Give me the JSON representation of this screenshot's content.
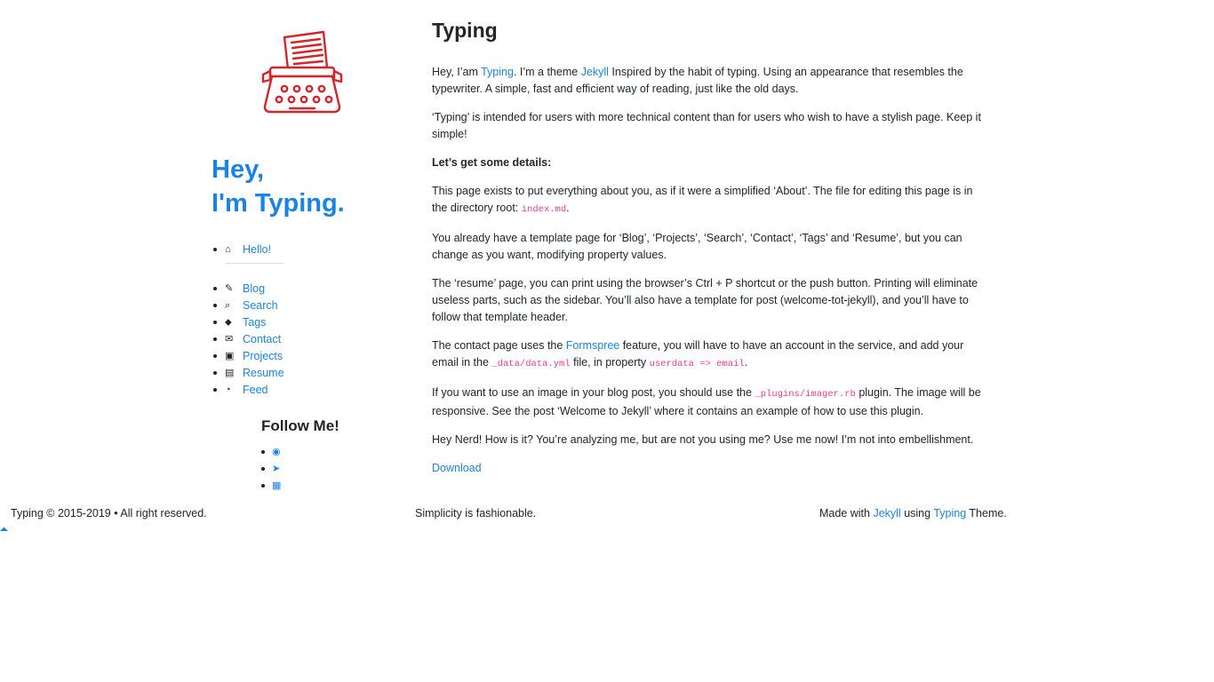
{
  "sidebar": {
    "greeting_line1": "Hey,",
    "greeting_line2": "I'm Typing.",
    "nav_top": [
      {
        "label": "Hello!",
        "icon": "home-icon"
      }
    ],
    "nav_items": [
      {
        "label": "Blog",
        "icon": "edit-icon"
      },
      {
        "label": "Search",
        "icon": "search-icon"
      },
      {
        "label": "Tags",
        "icon": "tags-icon"
      },
      {
        "label": "Contact",
        "icon": "envelope-icon"
      },
      {
        "label": "Projects",
        "icon": "briefcase-icon"
      },
      {
        "label": "Resume",
        "icon": "file-icon"
      },
      {
        "label": "Feed",
        "icon": "rss-icon"
      }
    ],
    "follow_title": "Follow Me!",
    "social": [
      {
        "icon": "github-icon"
      },
      {
        "icon": "twitter-icon"
      },
      {
        "icon": "linkedin-icon"
      }
    ]
  },
  "content": {
    "title": "Typing",
    "p1": {
      "a": "Hey, I’am ",
      "link1": "Typing",
      "b": ". I’m a theme ",
      "link2": "Jekyll",
      "c": " Inspired by the habit of typing. Using an appearance that resembles the typewriter. A simple, fast and efficient way of reading, just like the old days."
    },
    "p2": "‘Typing’ is intended for users with more technical content than for users who wish to have a stylish page. Keep it simple!",
    "p3": "Let’s get some details:",
    "p4": {
      "a": "This page exists to put everything about you, as if it were a simplified ‘About’. The file for editing this page is in the directory root: ",
      "code": "index.md",
      "b": "."
    },
    "p5": "You already have a template page for ‘Blog’, ‘Projects’, ‘Search’, ‘Contact’, ‘Tags’ and ‘Resume’, but you can change as you want, modifying property values.",
    "p6": "The ‘resume’ page, you can print using the browser’s Ctrl + P shortcut or the push button. Printing will eliminate useless parts, such as the sidebar. You’ll also have a template for post (welcome-tot-jekyll), and you’ll have to follow that template header.",
    "p7": {
      "a": "The contact page uses the ",
      "link": "Formspree",
      "b": " feature, you will have to have an account in the service, and add your email in the ",
      "code1": "_data/data.yml",
      "c": " file, in property ",
      "code2": "userdata => email",
      "d": "."
    },
    "p8": {
      "a": "If you want to use an image in your blog post, you should use the ",
      "code": "_plugins/imager.rb",
      "b": " plugin. The image will be responsive. See the post ‘Welcome to Jekyll’ where it contains an example of how to use this plugin."
    },
    "p9": "Hey Nerd! How is it? You’re analyzing me, but are not you using me? Use me now! I’m not into embellishment.",
    "download": "Download"
  },
  "footer": {
    "left": "Typing © 2015-2019 • All right reserved.",
    "center": "Simplicity is fashionable.",
    "right_a": "Made with ",
    "right_link1": "Jekyll",
    "right_b": " using ",
    "right_link2": "Typing",
    "right_c": " Theme."
  },
  "colors": {
    "accent": "#1a84e3",
    "logo": "#d8232a",
    "code": "#e83e8c"
  }
}
